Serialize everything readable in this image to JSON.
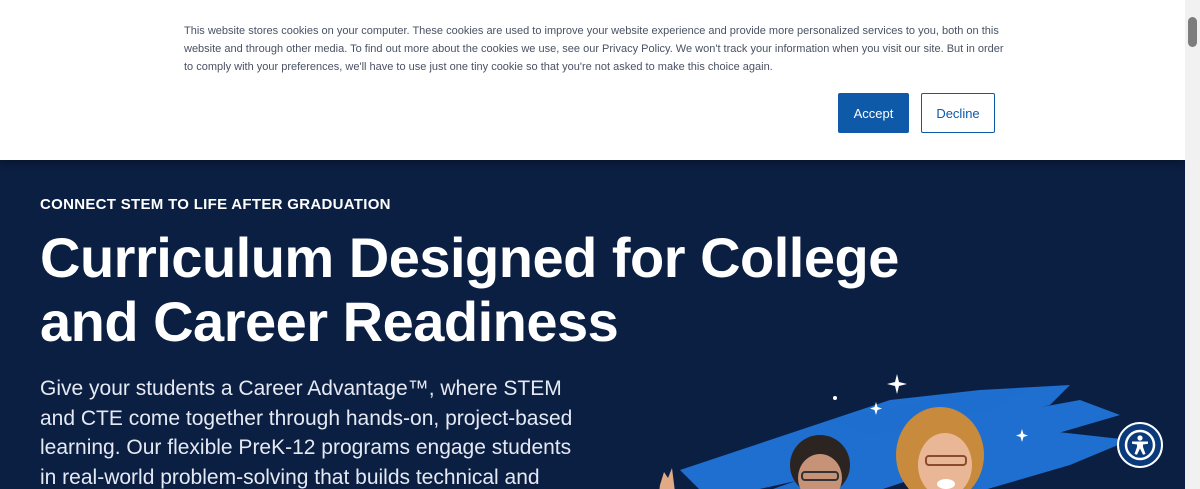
{
  "cookie_banner": {
    "text": "This website stores cookies on your computer. These cookies are used to improve your website experience and provide more personalized services to you, both on this website and through other media. To find out more about the cookies we use, see our Privacy Policy. We won't track your information when you visit our site. But in order to comply with your preferences, we'll have to use just one tiny cookie so that you're not asked to make this choice again.",
    "accept_label": "Accept",
    "decline_label": "Decline"
  },
  "hero": {
    "eyebrow": "CONNECT STEM TO LIFE AFTER GRADUATION",
    "headline": "Curriculum Designed for College and Career Readiness",
    "body": "Give your students a Career Advantage™, where STEM and CTE come together through hands-on, project-based learning. Our flexible PreK-12 programs engage students in real-world problem-solving that builds technical and"
  },
  "icons": {
    "accessibility": "accessibility-icon",
    "sparkle": "sparkle-icon"
  },
  "colors": {
    "hero_background": "#0b1f43",
    "accent_blue": "#0f5aa8",
    "brush_blue": "#1e6fd0",
    "banner_text": "#4a5263"
  }
}
